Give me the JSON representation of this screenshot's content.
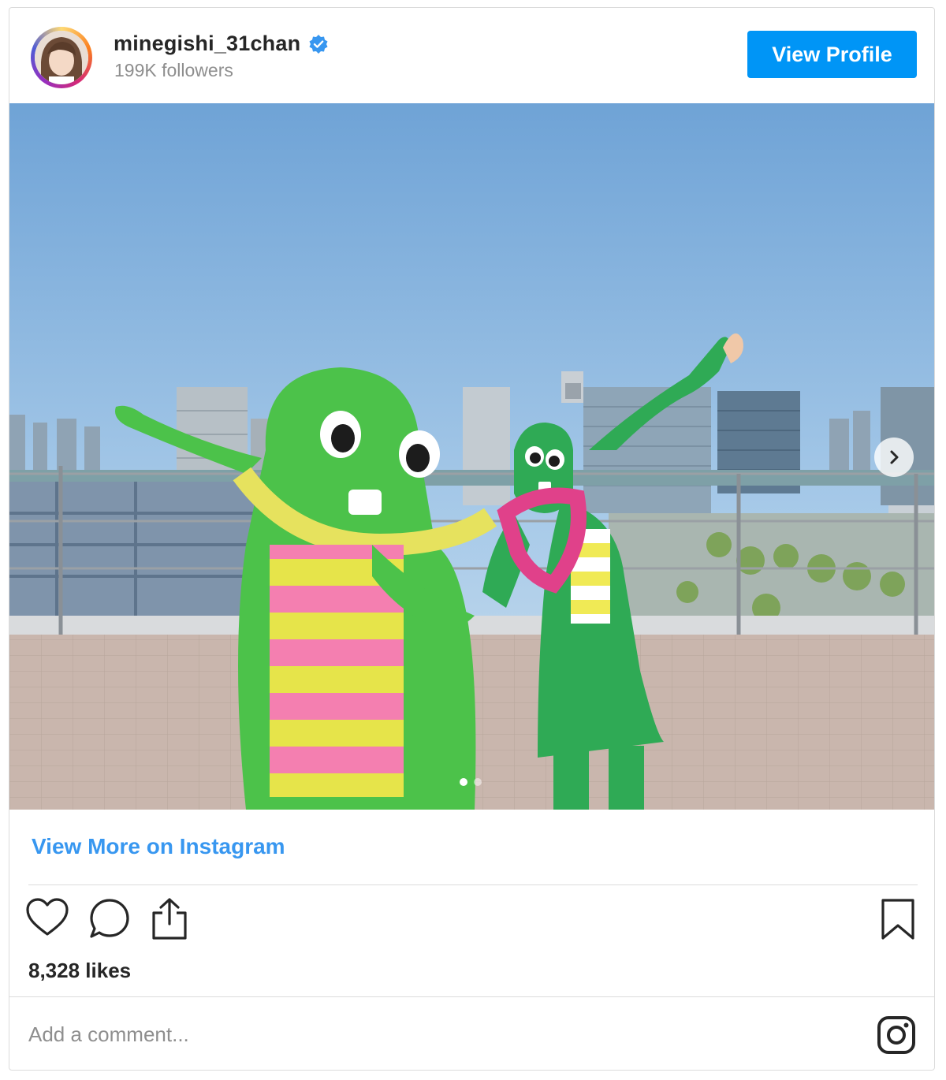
{
  "header": {
    "username": "minegishi_31chan",
    "followers": "199K followers",
    "view_profile_label": "View Profile",
    "verified_icon": "verified-badge-icon"
  },
  "post": {
    "carousel": {
      "slide_count": 2,
      "active_index": 0
    },
    "view_more_label": "View More on Instagram",
    "likes": "8,328 likes"
  },
  "actions": {
    "like": "heart-icon",
    "comment": "comment-icon",
    "share": "share-icon",
    "save": "bookmark-icon"
  },
  "comment_box": {
    "placeholder": "Add a comment..."
  },
  "colors": {
    "accent": "#0095f6",
    "link": "#3897f0",
    "verified": "#3897f0",
    "text": "#262626",
    "muted": "#8e8e8e"
  }
}
